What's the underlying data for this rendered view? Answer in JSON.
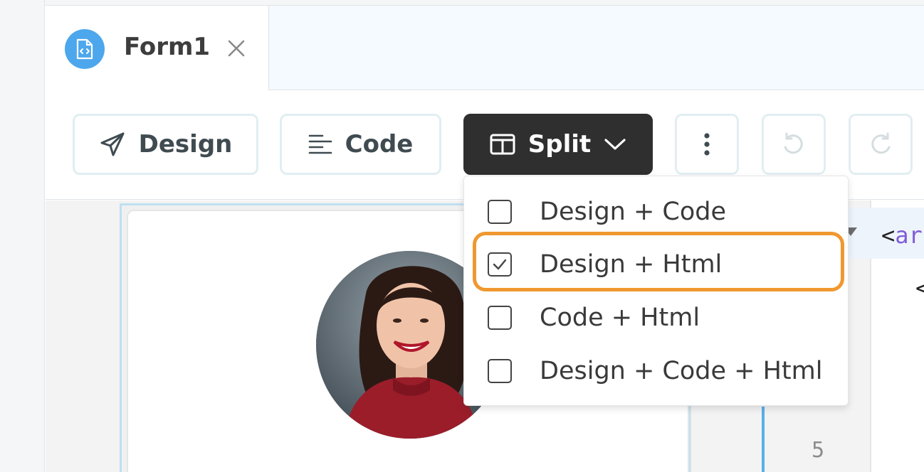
{
  "tab": {
    "label": "Form1",
    "icon": "code-file-icon"
  },
  "toolbar": {
    "design_label": "Design",
    "code_label": "Code",
    "split_label": "Split"
  },
  "dropdown": {
    "items": [
      {
        "label": "Design + Code",
        "checked": false
      },
      {
        "label": "Design + Html",
        "checked": true
      },
      {
        "label": "Code + Html",
        "checked": false
      },
      {
        "label": "Design + Code + Html",
        "checked": false
      }
    ]
  },
  "code": {
    "line1": "<",
    "line1_tag": "ar",
    "line2": "<",
    "line_number": "5"
  },
  "colors": {
    "accent_blue": "#4da7ec",
    "split_bg": "#2f2f2f",
    "highlight_orange": "#f0982f"
  }
}
